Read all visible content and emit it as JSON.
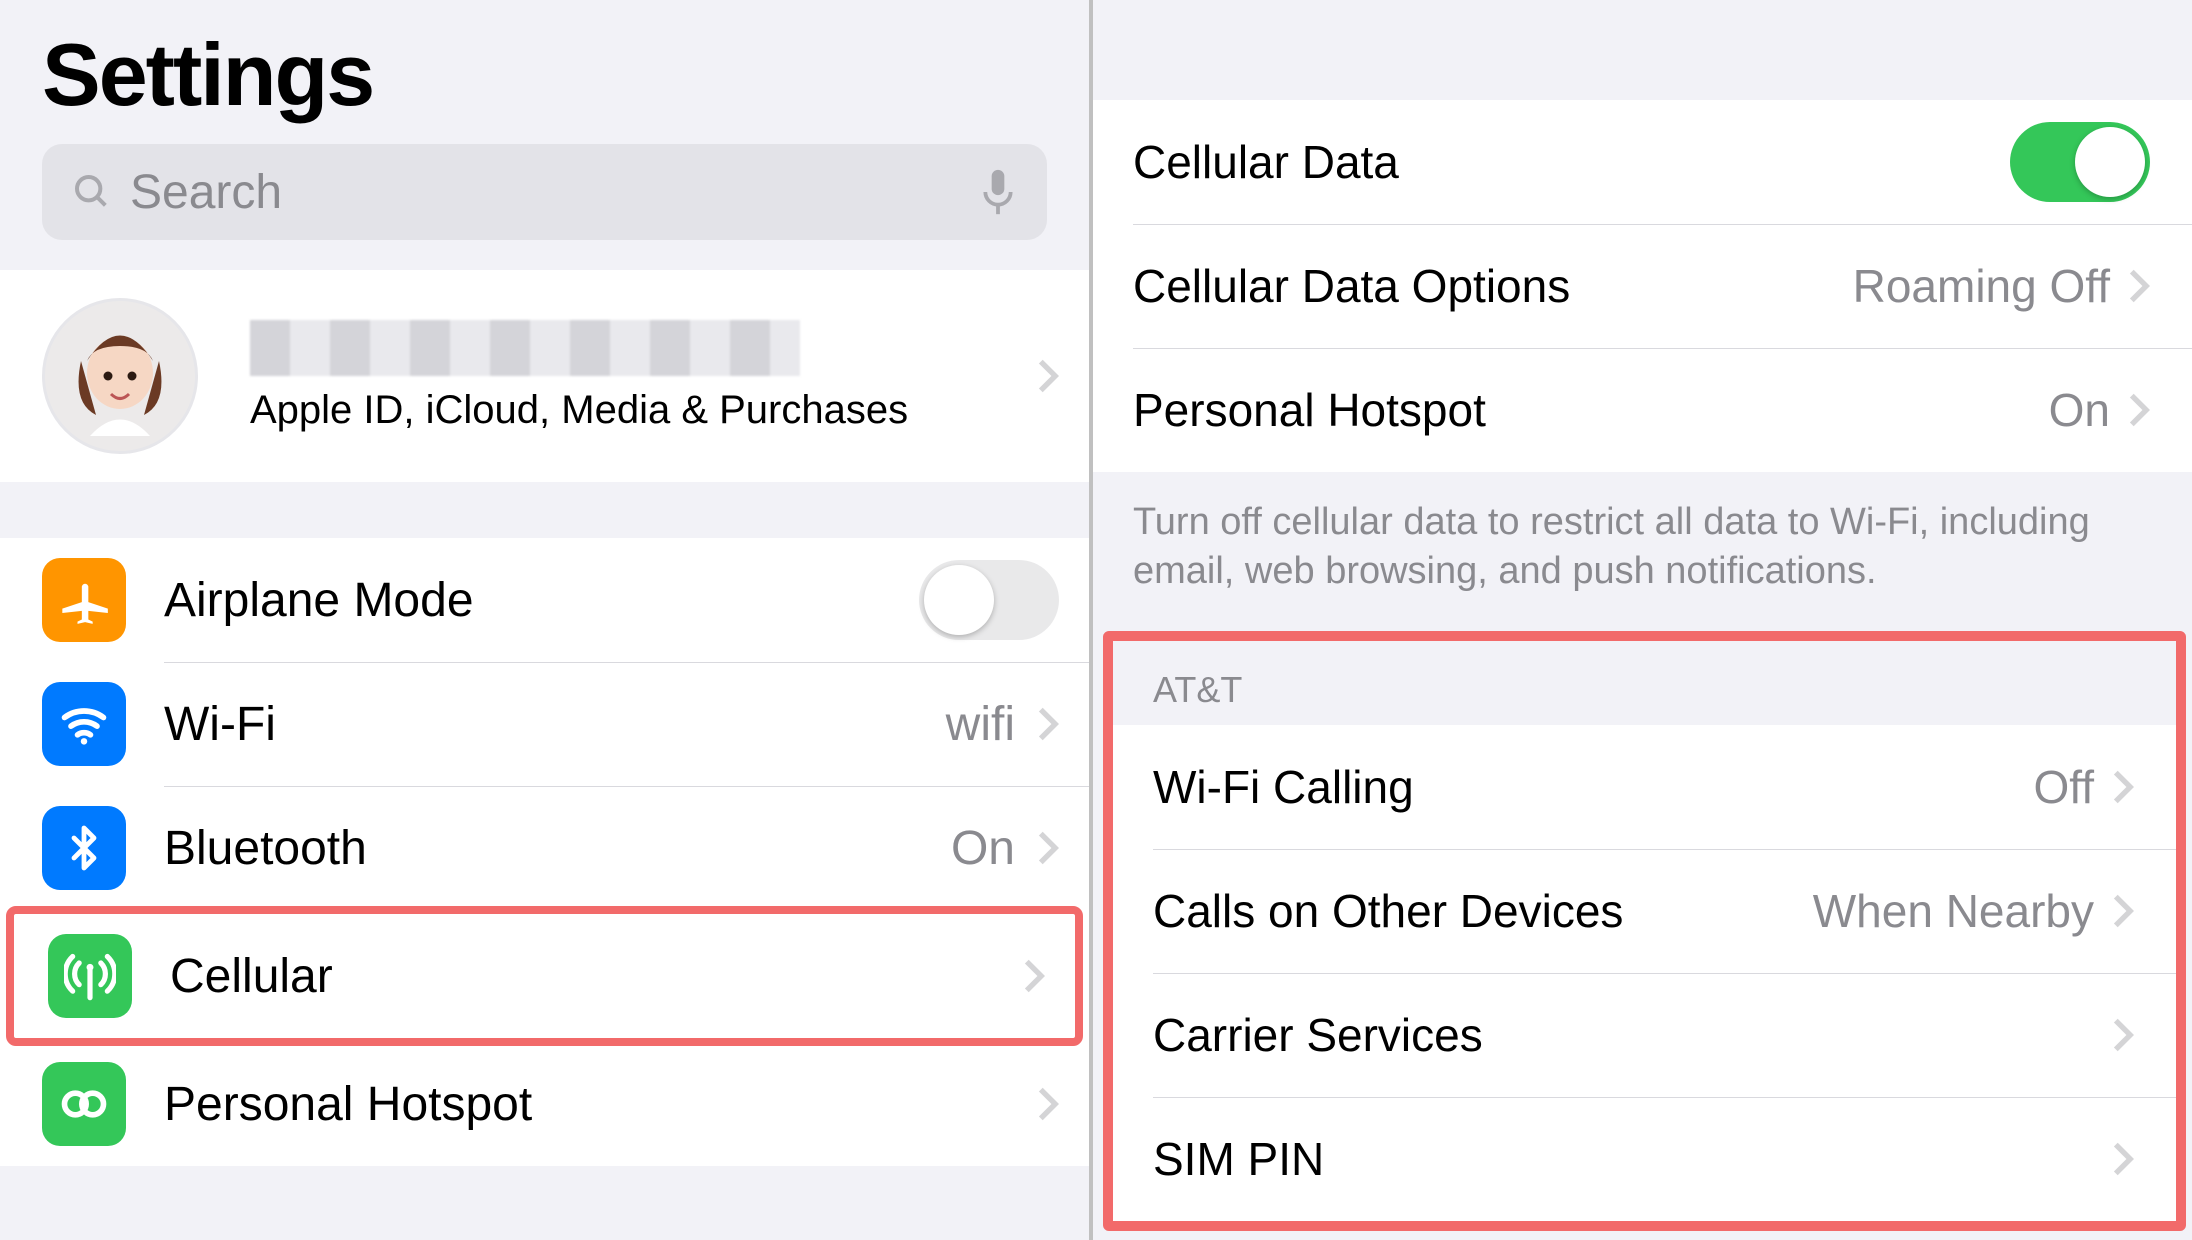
{
  "left": {
    "title": "Settings",
    "search_placeholder": "Search",
    "account": {
      "subtitle": "Apple ID, iCloud, Media & Purchases"
    },
    "items": {
      "airplane": {
        "label": "Airplane Mode",
        "toggle": false
      },
      "wifi": {
        "label": "Wi-Fi",
        "value": "wifi"
      },
      "bluetooth": {
        "label": "Bluetooth",
        "value": "On"
      },
      "cellular": {
        "label": "Cellular"
      },
      "hotspot": {
        "label": "Personal Hotspot"
      }
    }
  },
  "right": {
    "group1": {
      "cellular_data": {
        "label": "Cellular Data",
        "toggle": true
      },
      "data_options": {
        "label": "Cellular Data Options",
        "value": "Roaming Off"
      },
      "hotspot": {
        "label": "Personal Hotspot",
        "value": "On"
      }
    },
    "footer": "Turn off cellular data to restrict all data to Wi-Fi, including email, web browsing, and push notifications.",
    "carrier_section_title": "AT&T",
    "group2": {
      "wifi_calling": {
        "label": "Wi-Fi Calling",
        "value": "Off"
      },
      "calls_other": {
        "label": "Calls on Other Devices",
        "value": "When Nearby"
      },
      "carrier_svcs": {
        "label": "Carrier Services"
      },
      "sim_pin": {
        "label": "SIM PIN"
      }
    }
  }
}
